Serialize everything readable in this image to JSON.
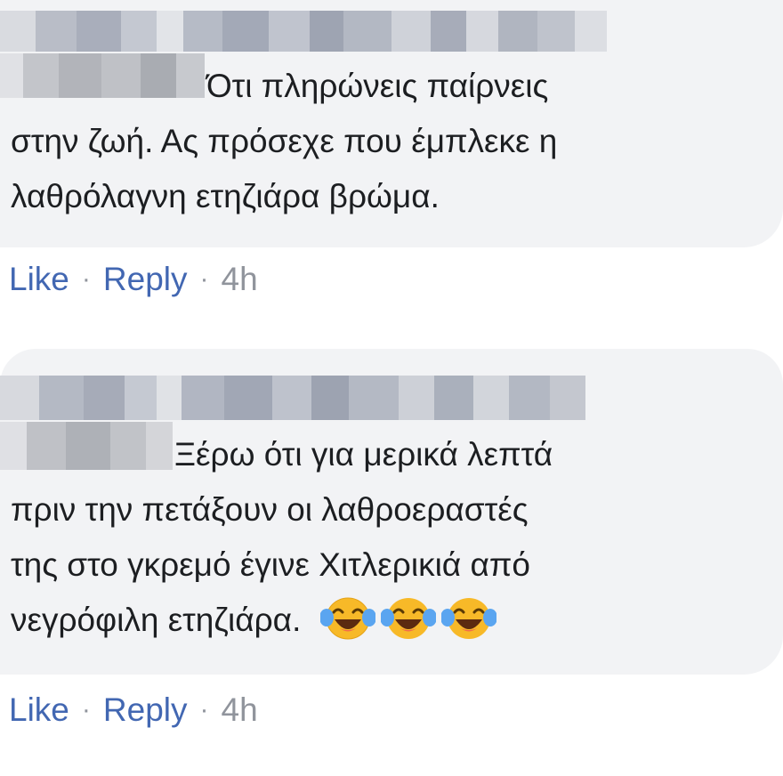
{
  "comments": [
    {
      "author_blurred": true,
      "lines": [
        "Ότι πληρώνεις παίρνεις",
        "στην ζωή. Ας πρόσεχε που έμπλεκε η",
        "λαθρόλαγνη ετηζιάρα βρώμα."
      ],
      "emojis": [],
      "like_label": "Like",
      "reply_label": "Reply",
      "separator": "·",
      "timestamp": "4h"
    },
    {
      "author_blurred": true,
      "lines": [
        "Ξέρω ότι για μερικά λεπτά",
        "πριν την πετάξουν οι λαθροεραστές",
        "της στο γκρεμό έγινε Χιτλερικιά από",
        "νεγρόφιλη ετηζιάρα."
      ],
      "emojis": [
        "tears-of-joy-emoji",
        "tears-of-joy-emoji",
        "tears-of-joy-emoji"
      ],
      "like_label": "Like",
      "reply_label": "Reply",
      "separator": "·",
      "timestamp": "4h"
    }
  ],
  "colors": {
    "bubble_bg": "#f2f3f5",
    "text": "#1c1e21",
    "link": "#4267b2",
    "meta": "#90949c"
  }
}
